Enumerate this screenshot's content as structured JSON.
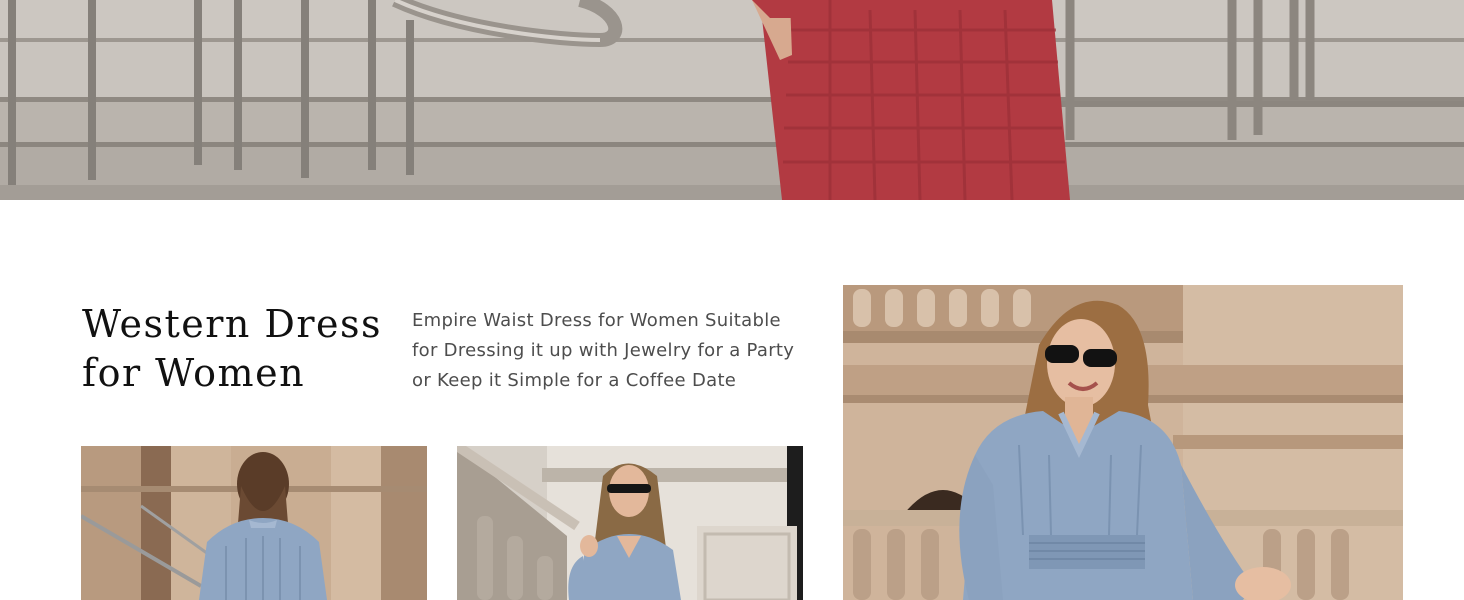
{
  "section": {
    "title_line_1": "Western Dress",
    "title_line_2": "for Women",
    "description": "Empire Waist Dress for Women Suitable for Dressing it up with Jewelry for a Party or Keep it Simple for a Coffee Date"
  },
  "images": {
    "hero": "hero-photo",
    "back_view": "back-view-photo",
    "front_view": "front-view-photo",
    "feature": "feature-photo"
  },
  "colors": {
    "accent_dress_red": "#b23a42",
    "dress_blue": "#8fa6c3",
    "stone": "#c9ad92",
    "text_dark": "#111111",
    "text_body": "#4d4d4d"
  }
}
